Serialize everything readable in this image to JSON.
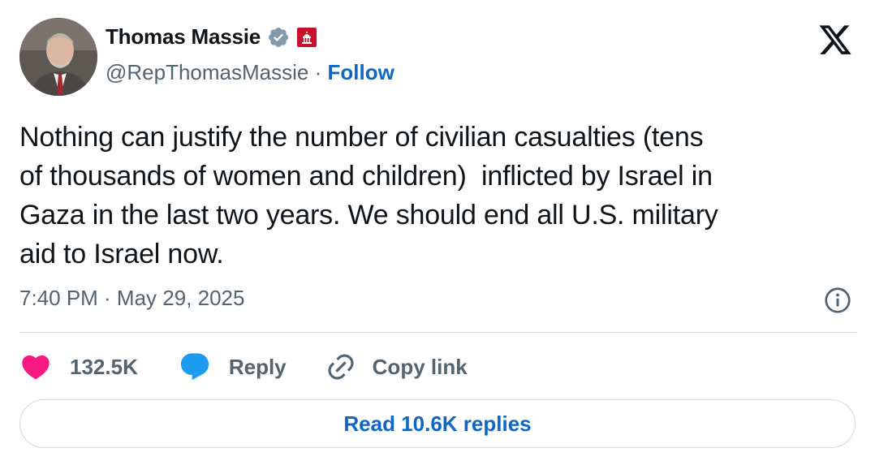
{
  "author": {
    "display_name": "Thomas Massie",
    "handle": "@RepThomasMassie",
    "separator": " · ",
    "follow_label": "Follow",
    "avatar_icon": "profile-photo",
    "verified_color": "#829aab",
    "badge_color": "#c8102e"
  },
  "tweet": {
    "text": "Nothing can justify the number of civilian casualties (tens\nof thousands of women and children)  inflicted by Israel in\nGaza in the last two years. We should end all U.S. military\naid to Israel now.",
    "timestamp": "7:40 PM · May 29, 2025"
  },
  "actions": {
    "likes_count": "132.5K",
    "reply_label": "Reply",
    "copy_link_label": "Copy link",
    "like_color": "#f91880",
    "reply_color": "#1d9bf0"
  },
  "read_replies_label": "Read 10.6K replies",
  "colors": {
    "accent": "#0f66c4",
    "secondary_text": "#536471",
    "border": "#cfd9de"
  }
}
